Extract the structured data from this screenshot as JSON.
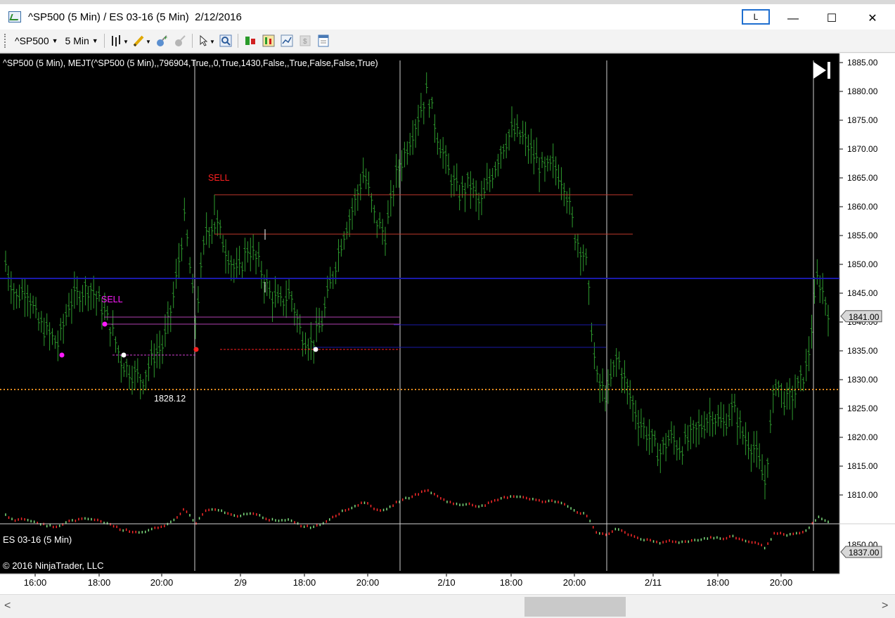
{
  "window": {
    "title": "^SP500 (5 Min) / ES 03-16 (5 Min)  2/12/2016",
    "l_button": "L",
    "minimize": "—",
    "maximize": "☐",
    "close": "✕"
  },
  "toolbar": {
    "instrument": "^SP500",
    "interval": "5 Min",
    "icons": [
      "bar-style-icon",
      "drawing-pencil-icon",
      "add-indicator-icon",
      "remove-indicator-icon",
      "pointer-icon",
      "zoom-icon",
      "strategy-icon",
      "data-box-icon",
      "chart-trader-icon",
      "money-icon",
      "properties-icon"
    ]
  },
  "chart": {
    "indicator_label": "^SP500 (5 Min), MEJT(^SP500 (5 Min),,796904,True,,0,True,1430,False,,True,False,False,True)",
    "price_ticks": [
      "1885.00",
      "1880.00",
      "1875.00",
      "1870.00",
      "1865.00",
      "1860.00",
      "1855.00",
      "1850.00",
      "1845.00",
      "1840.00",
      "1835.00",
      "1830.00",
      "1825.00",
      "1820.00",
      "1815.00",
      "1810.00"
    ],
    "last_price": "1841.00",
    "sell_label_1": "SELL",
    "sell_label_2": "SELL",
    "low_label": "1828.12",
    "lower_panel_label": "ES 03-16 (5 Min)",
    "lower_tick": "1850.00",
    "lower_last_price": "1837.00",
    "copyright": "© 2016 NinjaTrader, LLC",
    "time_labels": [
      "16:00",
      "18:00",
      "20:00",
      "2/9",
      "18:00",
      "20:00",
      "2/10",
      "18:00",
      "20:00",
      "2/11",
      "18:00",
      "20:00"
    ],
    "colors": {
      "background": "#000000",
      "bars": "#2e9b2e",
      "sell_line": "#c0392b",
      "purple_line": "#b040b0",
      "blue_line": "#1a1aa8",
      "orange_line": "#e08a20"
    }
  },
  "chart_data": {
    "type": "ohlc",
    "series": [
      {
        "name": "^SP500 (5 Min)",
        "close_path": [
          1850,
          1844,
          1846,
          1840,
          1838,
          1836,
          1843,
          1845,
          1846,
          1843,
          1839,
          1833,
          1831,
          1830,
          1834,
          1836,
          1845,
          1858,
          1840,
          1856,
          1857,
          1852,
          1848,
          1853,
          1850,
          1845,
          1843,
          1845,
          1838,
          1836,
          1840,
          1848,
          1855,
          1860,
          1866,
          1858,
          1855,
          1865,
          1870,
          1875,
          1880,
          1872,
          1866,
          1862,
          1864,
          1860,
          1865,
          1870,
          1873,
          1872,
          1869,
          1866,
          1867,
          1864,
          1855,
          1851,
          1830,
          1827,
          1834,
          1828,
          1823,
          1820,
          1817,
          1820,
          1818,
          1820,
          1822,
          1824,
          1822,
          1825,
          1820,
          1818,
          1812,
          1830,
          1826,
          1828,
          1832,
          1848,
          1842
        ]
      }
    ],
    "ylim": [
      1810,
      1885
    ],
    "annotations": [
      "SELL",
      "SELL",
      "1828.12"
    ],
    "last_price": 1841.0
  }
}
